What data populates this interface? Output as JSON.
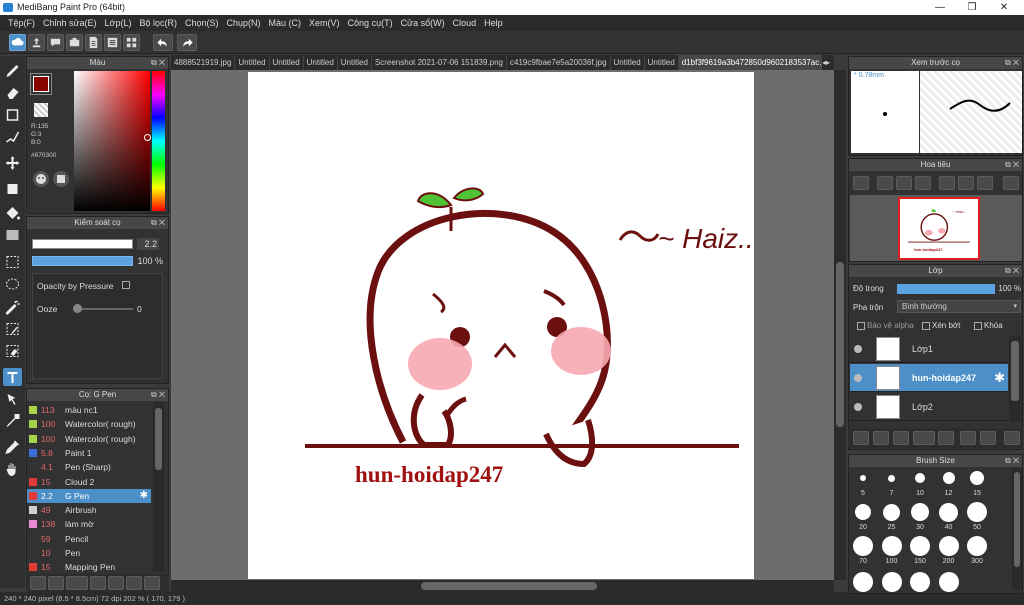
{
  "window": {
    "title": "MediBang Paint Pro (64bit)",
    "minimize": "—",
    "maximize": "❒",
    "close": "✕"
  },
  "menu": [
    "Tệp(F)",
    "Chỉnh sửa(E)",
    "Lớp(L)",
    "Bộ lọc(R)",
    "Chọn(S)",
    "Chụp(N)",
    "Màu (C)",
    "Xem(V)",
    "Công cụ(T)",
    "Cửa sổ(W)",
    "Cloud",
    "Help"
  ],
  "colorpanel": {
    "title": "Màu",
    "r": "R:135",
    "g": "G:3",
    "b": "B:0",
    "hex": "#870300",
    "primary": "#870300",
    "secondary": "#ffffff"
  },
  "brushctrl": {
    "title": "Kiểm soát cọ",
    "size": "2.2",
    "opacity": "100 %",
    "pressure_label": "Opacity by Pressure",
    "ooze_label": "Ooze",
    "ooze_value": "0"
  },
  "brushes": {
    "title": "Cọ: G Pen",
    "items": [
      {
        "size": "113",
        "name": "màu nc1",
        "color": "#a7d44a"
      },
      {
        "size": "100",
        "name": "Watercolor( rough)",
        "color": "#a7d44a"
      },
      {
        "size": "100",
        "name": "Watercolor( rough)",
        "color": "#a7d44a"
      },
      {
        "size": "5.8",
        "name": "Paint 1",
        "color": "#3a6fd8"
      },
      {
        "size": "4.1",
        "name": "Pen (Sharp)",
        "color": "#333333"
      },
      {
        "size": "15",
        "name": "Cloud 2",
        "color": "#e03a3a"
      },
      {
        "size": "2.2",
        "name": "G Pen",
        "color": "#e03a3a"
      },
      {
        "size": "49",
        "name": "Airbrush",
        "color": "#cfcfcf"
      },
      {
        "size": "138",
        "name": "làm mờ",
        "color": "#e78ad0"
      },
      {
        "size": "59",
        "name": "Pencil",
        "color": "#333333"
      },
      {
        "size": "10",
        "name": "Pen",
        "color": "#333333"
      },
      {
        "size": "15",
        "name": "Mapping Pen",
        "color": "#e03a3a"
      }
    ]
  },
  "tabs": [
    {
      "label": "4888521919.jpg",
      "active": false
    },
    {
      "label": "Untitled",
      "active": false
    },
    {
      "label": "Untitled",
      "active": false
    },
    {
      "label": "Untitled",
      "active": false
    },
    {
      "label": "Untitled",
      "active": false
    },
    {
      "label": "Screenshot 2021-07-06 151839.png",
      "active": false
    },
    {
      "label": "c419c9fbae7e5a20036f.jpg",
      "active": false
    },
    {
      "label": "Untitled",
      "active": false
    },
    {
      "label": "Untitled",
      "active": false
    },
    {
      "label": "d1bf3f9619a3b472850d9602183537ac.jpg",
      "active": true
    }
  ],
  "artwork": {
    "speech": "~ Haiz...",
    "caption": "hun-hoidap247",
    "line_color": "#6b0f0f",
    "cheek_color": "#f7a8b0",
    "leaf_color": "#4fc235"
  },
  "preview": {
    "title": "Xem trước cọ",
    "size": "* 0.78mm"
  },
  "navigator": {
    "title": "Hoa tiêu",
    "thumb_text": "~ Haiz...",
    "thumb_caption": "hun-hoidap247"
  },
  "layers": {
    "title": "Lớp",
    "opacity_label": "Độ trong",
    "opacity": "100 %",
    "blend_label": "Pha trộn",
    "blend": "Bình thường",
    "protect_alpha": "Bảo vệ alpha",
    "clip": "Xén bớt",
    "lock": "Khóa",
    "items": [
      {
        "name": "Lớp1",
        "selected": false
      },
      {
        "name": "hun-hoidap247",
        "selected": true
      },
      {
        "name": "Lớp2",
        "selected": false
      }
    ]
  },
  "brushsize": {
    "title": "Brush Size",
    "sizes": [
      "5",
      "7",
      "10",
      "12",
      "15",
      "20",
      "25",
      "30",
      "40",
      "50",
      "70",
      "100",
      "150",
      "200",
      "300"
    ]
  },
  "status": {
    "text": "240 * 240 pixel    (8.5 * 8.5cm)  72 dpi  202 %    ( 170, 179 )"
  }
}
